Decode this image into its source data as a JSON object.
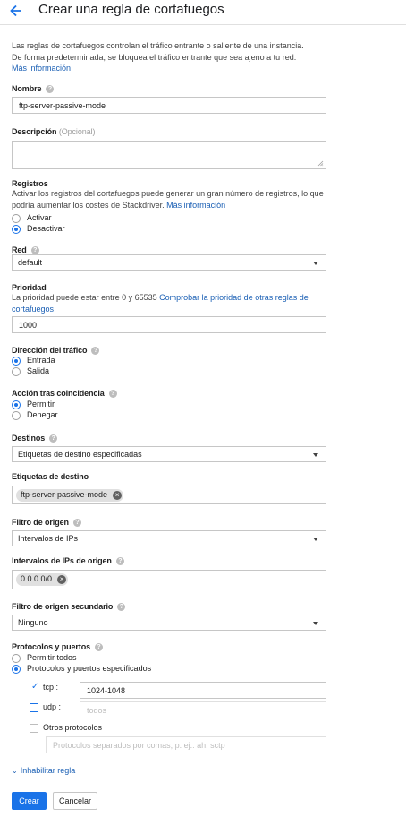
{
  "page": {
    "title": "Crear una regla de cortafuegos"
  },
  "intro": {
    "line1": "Las reglas de cortafuegos controlan el tráfico entrante o saliente de una instancia.",
    "line2": "De forma predeterminada, se bloquea el tráfico entrante que sea ajeno a tu red.",
    "more_link": "Más información"
  },
  "name": {
    "label": "Nombre",
    "value": "ftp-server-passive-mode"
  },
  "description": {
    "label": "Descripción",
    "optional": "(Opcional)",
    "value": ""
  },
  "logs": {
    "label": "Registros",
    "desc_line1": "Activar los registros del cortafuegos puede generar un gran número de registros, lo que",
    "desc_line2": "podría aumentar los costes de Stackdriver.",
    "more_link": "Más información",
    "options": [
      "Activar",
      "Desactivar"
    ],
    "selected": "Desactivar"
  },
  "network": {
    "label": "Red",
    "value": "default"
  },
  "priority": {
    "label": "Prioridad",
    "desc": "La prioridad puede estar entre 0 y 65535",
    "link_line1": "Comprobar la prioridad de otras reglas de",
    "link_line2": "cortafuegos",
    "value": "1000"
  },
  "direction": {
    "label": "Dirección del tráfico",
    "options": [
      "Entrada",
      "Salida"
    ],
    "selected": "Entrada"
  },
  "action": {
    "label": "Acción tras coincidencia",
    "options": [
      "Permitir",
      "Denegar"
    ],
    "selected": "Permitir"
  },
  "targets": {
    "label": "Destinos",
    "value": "Etiquetas de destino especificadas"
  },
  "target_tags": {
    "label": "Etiquetas de destino",
    "chip": "ftp-server-passive-mode"
  },
  "source_filter": {
    "label": "Filtro de origen",
    "value": "Intervalos de IPs"
  },
  "source_ranges": {
    "label": "Intervalos de IPs de origen",
    "chip": "0.0.0.0/0"
  },
  "secondary_filter": {
    "label": "Filtro de origen secundario",
    "value": "Ninguno"
  },
  "protocols": {
    "label": "Protocolos y puertos",
    "options": [
      "Permitir todos",
      "Protocolos y puertos especificados"
    ],
    "selected": "Protocolos y puertos especificados",
    "tcp": {
      "label": "tcp :",
      "checked": true,
      "value": "1024-1048"
    },
    "udp": {
      "label": "udp :",
      "checked": false,
      "placeholder": "todos"
    },
    "other": {
      "label": "Otros protocolos",
      "checked": false,
      "placeholder": "Protocolos separados por comas, p. ej.: ah, sctp"
    }
  },
  "disable_rule": {
    "label": "Inhabilitar regla"
  },
  "actions": {
    "create": "Crear",
    "cancel": "Cancelar"
  },
  "colors": {
    "accent": "#1a73e8",
    "link": "#1a5fb4"
  }
}
